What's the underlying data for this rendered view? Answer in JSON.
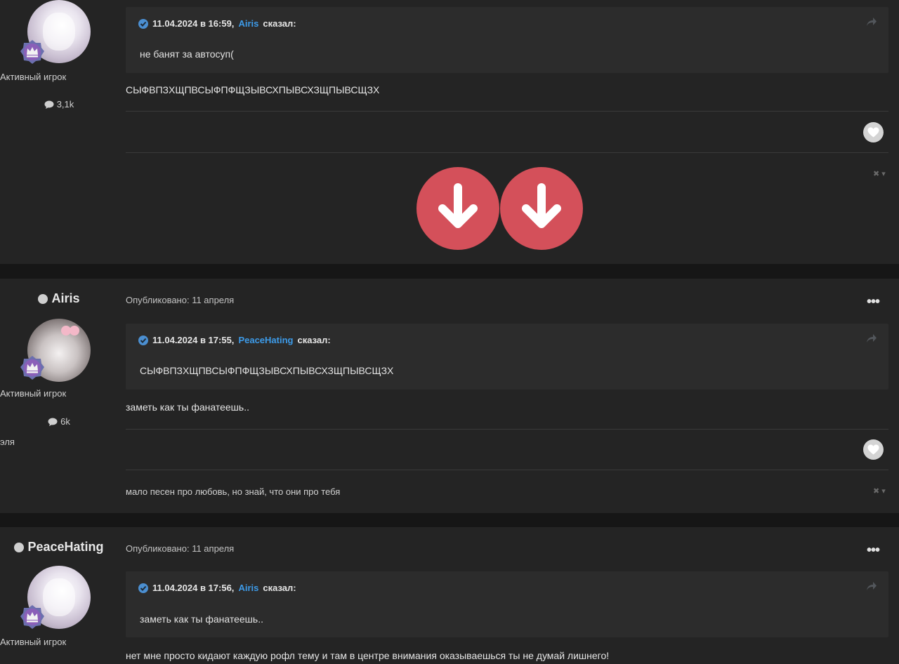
{
  "posts": [
    {
      "author_name": "",
      "rank_title": "Активный игрок",
      "post_count": "3,1k",
      "quote": {
        "header": "11.04.2024 в 16:59,",
        "user": "Airis",
        "said": "сказал:",
        "text": "не банят за автосуп("
      },
      "content": "СЫФВПЗХЩПВСЫФПФЩЗЫВСХПЫВСХЗЩПЫВСЩЗХ",
      "signature_controls": "✖ ▾"
    },
    {
      "author_name": "Airis",
      "published": "Опубликовано: 11 апреля",
      "more_label": "•••",
      "rank_title": "Активный игрок",
      "post_count": "6k",
      "custom_title": "эля",
      "quote": {
        "header": "11.04.2024 в 17:55,",
        "user": "PeaceHating",
        "said": "сказал:",
        "text": "СЫФВПЗХЩПВСЫФПФЩЗЫВСХПЫВСХЗЩПЫВСЩЗХ"
      },
      "content": "заметь как ты фанатеешь..",
      "signature": "мало песен про любовь, но знай, что они про тебя",
      "signature_controls": "✖ ▾"
    },
    {
      "author_name": "PeaceHating",
      "published": "Опубликовано: 11 апреля",
      "more_label": "•••",
      "rank_title": "Активный игрок",
      "quote": {
        "header": "11.04.2024 в 17:56,",
        "user": "Airis",
        "said": "сказал:",
        "text": "заметь как ты фанатеешь.."
      },
      "content": "нет мне просто кидают каждую рофл тему и там в центре внимания оказываешься ты не думай лишнего!"
    }
  ],
  "overlay": {
    "arrow_icon": "arrow-down-circle-icon",
    "arrow_color": "#d4505a"
  },
  "colors": {
    "link": "#3d9be9",
    "background": "#161616",
    "post_background": "#242424",
    "quote_background": "#2c2c2c"
  }
}
